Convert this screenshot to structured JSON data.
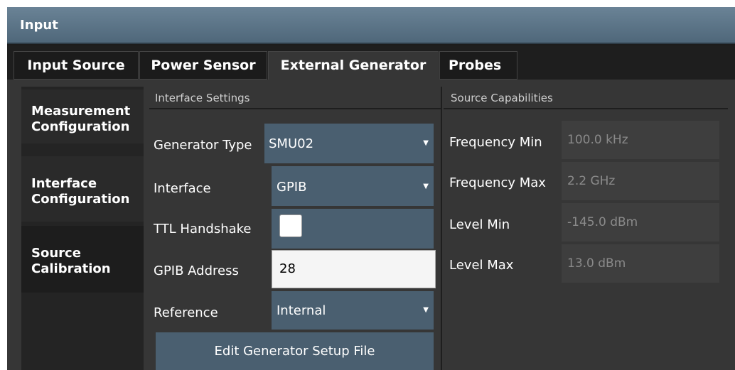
{
  "window": {
    "title": "Input"
  },
  "tabs": [
    {
      "label": "Input Source"
    },
    {
      "label": "Power Sensor"
    },
    {
      "label": "External Generator",
      "active": true
    },
    {
      "label": "Probes"
    }
  ],
  "sidebar": {
    "items": [
      {
        "lines": [
          "Measurement",
          "Configuration"
        ]
      },
      {
        "lines": [
          "Interface",
          "Configuration"
        ]
      },
      {
        "lines": [
          "Source",
          "Calibration"
        ],
        "active": true
      }
    ]
  },
  "interface": {
    "title": "Interface Settings",
    "generator_type": {
      "label": "Generator Type",
      "value": "SMU02"
    },
    "interface": {
      "label": "Interface",
      "value": "GPIB"
    },
    "ttl_handshake": {
      "label": "TTL Handshake",
      "checked": false
    },
    "gpib_address": {
      "label": "GPIB Address",
      "value": "28"
    },
    "reference": {
      "label": "Reference",
      "value": "Internal"
    },
    "edit_button": "Edit Generator Setup File"
  },
  "capabilities": {
    "title": "Source Capabilities",
    "rows": [
      {
        "label": "Frequency Min",
        "value": "100.0 kHz"
      },
      {
        "label": "Frequency Max",
        "value": "2.2 GHz"
      },
      {
        "label": "Level Min",
        "value": "-145.0 dBm"
      },
      {
        "label": "Level Max",
        "value": "13.0 dBm"
      }
    ]
  },
  "icons": {
    "dropdown": "caret-down-icon"
  },
  "colors": {
    "titlebar": "#5a7285",
    "field": "#4a5f70",
    "panel": "#363636"
  }
}
